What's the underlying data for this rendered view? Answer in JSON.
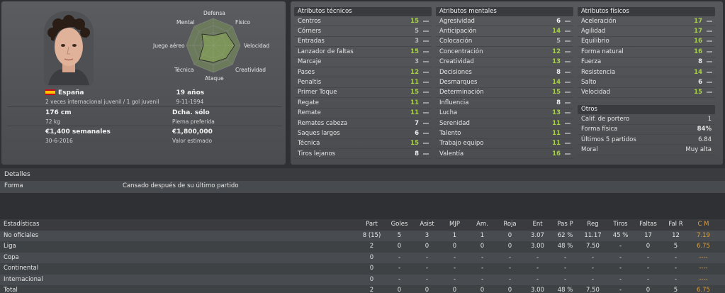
{
  "profile": {
    "radar_labels": {
      "defensa": "Defensa",
      "fisico": "Físico",
      "velocidad": "Velocidad",
      "creatividad": "Creatividad",
      "ataque": "Ataque",
      "tecnica": "Técnica",
      "juego_aereo": "Juego aéreo",
      "mental": "Mental"
    },
    "nationality": "España",
    "international": "2 veces internacional juvenil / 1 gol juvenil",
    "age": "19 años",
    "birthdate": "9-11-1994",
    "height": "176 cm",
    "weight": "72 kg",
    "foot": "Dcha. sólo",
    "foot_label": "Pierna preferida",
    "wage": "€1,400 semanales",
    "contract_end": "30-6-2016",
    "value": "€1,800,000",
    "value_label": "Valor estimado"
  },
  "technical": {
    "title": "Atributos técnicos",
    "rows": [
      {
        "name": "Centros",
        "value": "15",
        "tone": "green"
      },
      {
        "name": "Córners",
        "value": "5",
        "tone": "gray"
      },
      {
        "name": "Entradas",
        "value": "3",
        "tone": "gray"
      },
      {
        "name": "Lanzador de faltas",
        "value": "15",
        "tone": "green"
      },
      {
        "name": "Marcaje",
        "value": "3",
        "tone": "gray"
      },
      {
        "name": "Pases",
        "value": "12",
        "tone": "green"
      },
      {
        "name": "Penaltis",
        "value": "11",
        "tone": "green"
      },
      {
        "name": "Primer Toque",
        "value": "15",
        "tone": "green"
      },
      {
        "name": "Regate",
        "value": "11",
        "tone": "green"
      },
      {
        "name": "Remate",
        "value": "11",
        "tone": "green"
      },
      {
        "name": "Remates cabeza",
        "value": "7",
        "tone": "white"
      },
      {
        "name": "Saques largos",
        "value": "6",
        "tone": "white"
      },
      {
        "name": "Técnica",
        "value": "15",
        "tone": "green"
      },
      {
        "name": "Tiros lejanos",
        "value": "8",
        "tone": "white"
      }
    ]
  },
  "mental": {
    "title": "Atributos mentales",
    "rows": [
      {
        "name": "Agresividad",
        "value": "6",
        "tone": "white"
      },
      {
        "name": "Anticipación",
        "value": "14",
        "tone": "green"
      },
      {
        "name": "Colocación",
        "value": "5",
        "tone": "gray"
      },
      {
        "name": "Concentración",
        "value": "12",
        "tone": "green"
      },
      {
        "name": "Creatividad",
        "value": "13",
        "tone": "green"
      },
      {
        "name": "Decisiones",
        "value": "8",
        "tone": "white"
      },
      {
        "name": "Desmarques",
        "value": "14",
        "tone": "green"
      },
      {
        "name": "Determinación",
        "value": "15",
        "tone": "green"
      },
      {
        "name": "Influencia",
        "value": "8",
        "tone": "white"
      },
      {
        "name": "Lucha",
        "value": "13",
        "tone": "green"
      },
      {
        "name": "Serenidad",
        "value": "11",
        "tone": "green"
      },
      {
        "name": "Talento",
        "value": "11",
        "tone": "green"
      },
      {
        "name": "Trabajo equipo",
        "value": "11",
        "tone": "green"
      },
      {
        "name": "Valentía",
        "value": "16",
        "tone": "green"
      }
    ]
  },
  "physical": {
    "title": "Atributos físicos",
    "rows": [
      {
        "name": "Aceleración",
        "value": "17",
        "tone": "green"
      },
      {
        "name": "Agilidad",
        "value": "17",
        "tone": "green"
      },
      {
        "name": "Equilibrio",
        "value": "16",
        "tone": "green"
      },
      {
        "name": "Forma natural",
        "value": "16",
        "tone": "green"
      },
      {
        "name": "Fuerza",
        "value": "8",
        "tone": "white"
      },
      {
        "name": "Resistencia",
        "value": "14",
        "tone": "green"
      },
      {
        "name": "Salto",
        "value": "6",
        "tone": "white"
      },
      {
        "name": "Velocidad",
        "value": "15",
        "tone": "green"
      }
    ]
  },
  "otros": {
    "title": "Otros",
    "rows": [
      {
        "name": "Calif. de portero",
        "value": "1"
      },
      {
        "name": "Forma física",
        "value": "84%"
      },
      {
        "name": "Últimos 5 partidos",
        "value": "6.84"
      },
      {
        "name": "Moral",
        "value": "Muy alta"
      }
    ]
  },
  "details": {
    "title": "Detalles",
    "label": "Forma",
    "value": "Cansado después de su último partido"
  },
  "stats": {
    "title": "Estadísticas",
    "columns": [
      "Part",
      "Goles",
      "Asist",
      "MJP",
      "Am.",
      "Roja",
      "Ent",
      "Pas P",
      "Reg",
      "Tiros",
      "Faltas",
      "Fal R",
      "C M"
    ],
    "rows": [
      {
        "label": "No oficiales",
        "values": [
          "8 (15)",
          "5",
          "3",
          "1",
          "1",
          "0",
          "3.07",
          "62 %",
          "11.17",
          "45 %",
          "17",
          "12",
          "7.19"
        ]
      },
      {
        "label": "Liga",
        "values": [
          "2",
          "0",
          "0",
          "0",
          "0",
          "0",
          "3.00",
          "48 %",
          "7.50",
          "-",
          "0",
          "5",
          "6.75"
        ]
      },
      {
        "label": "Copa",
        "values": [
          "0",
          "-",
          "-",
          "-",
          "-",
          "-",
          "-",
          "-",
          "-",
          "-",
          "-",
          "-",
          "----"
        ]
      },
      {
        "label": "Continental",
        "values": [
          "0",
          "-",
          "-",
          "-",
          "-",
          "-",
          "-",
          "-",
          "-",
          "-",
          "-",
          "-",
          "----"
        ]
      },
      {
        "label": "Internacional",
        "values": [
          "0",
          "-",
          "-",
          "-",
          "-",
          "-",
          "-",
          "-",
          "-",
          "-",
          "-",
          "-",
          "----"
        ]
      },
      {
        "label": "Total",
        "values": [
          "2",
          "0",
          "0",
          "0",
          "0",
          "0",
          "3.00",
          "48 %",
          "7.50",
          "-",
          "0",
          "5",
          "6.75"
        ]
      }
    ]
  }
}
